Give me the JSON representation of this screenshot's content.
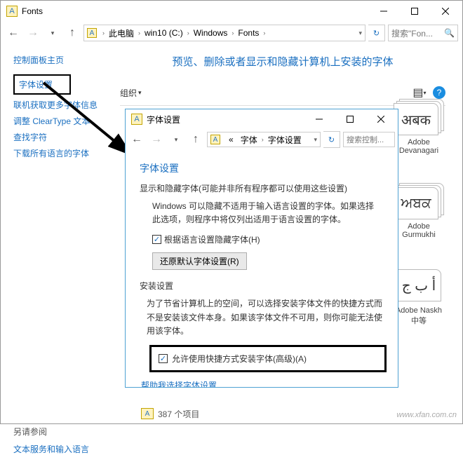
{
  "outer": {
    "title": "Fonts",
    "breadcrumb": [
      "此电脑",
      "win10 (C:)",
      "Windows",
      "Fonts"
    ],
    "search_placeholder": "搜索\"Fon...",
    "page_heading": "预览、删除或者显示和隐藏计算机上安装的字体",
    "organize": "组织",
    "status": "387 个项目",
    "watermark": "www.xfan.com.cn"
  },
  "sidebar": {
    "home": "控制面板主页",
    "items": [
      "字体设置",
      "联机获取更多字体信息",
      "调整 ClearType 文本",
      "查找字符",
      "下载所有语言的字体"
    ],
    "see_also_h": "另请参阅",
    "see_also_item": "文本服务和输入语言"
  },
  "tiles": [
    {
      "sample": "अबक",
      "label": "Adobe Devanagari"
    },
    {
      "sample": "ਅਬਕ",
      "label": "Adobe Gurmukhi"
    },
    {
      "sample": "أ ب ج",
      "label": "Adobe Naskh 中等"
    }
  ],
  "child": {
    "title": "字体设置",
    "breadcrumb_short": [
      "字体",
      "字体设置"
    ],
    "breadcrumb_prefix": "«",
    "search_placeholder": "搜索控制...",
    "heading": "字体设置",
    "hide_desc": "显示和隐藏字体(可能并非所有程序都可以使用这些设置)",
    "hide_body": "Windows 可以隐藏不适用于输入语言设置的字体。如果选择此选项，则程序中将仅列出适用于语言设置的字体。",
    "hide_chk": "根据语言设置隐藏字体(H)",
    "restore_btn": "还原默认字体设置(R)",
    "install_h": "安装设置",
    "install_body": "为了节省计算机上的空间，可以选择安装字体文件的快捷方式而不是安装该文件本身。如果该字体文件不可用，则你可能无法使用该字体。",
    "install_chk": "允许使用快捷方式安装字体(高级)(A)",
    "help_link": "帮助我选择字体设置"
  }
}
